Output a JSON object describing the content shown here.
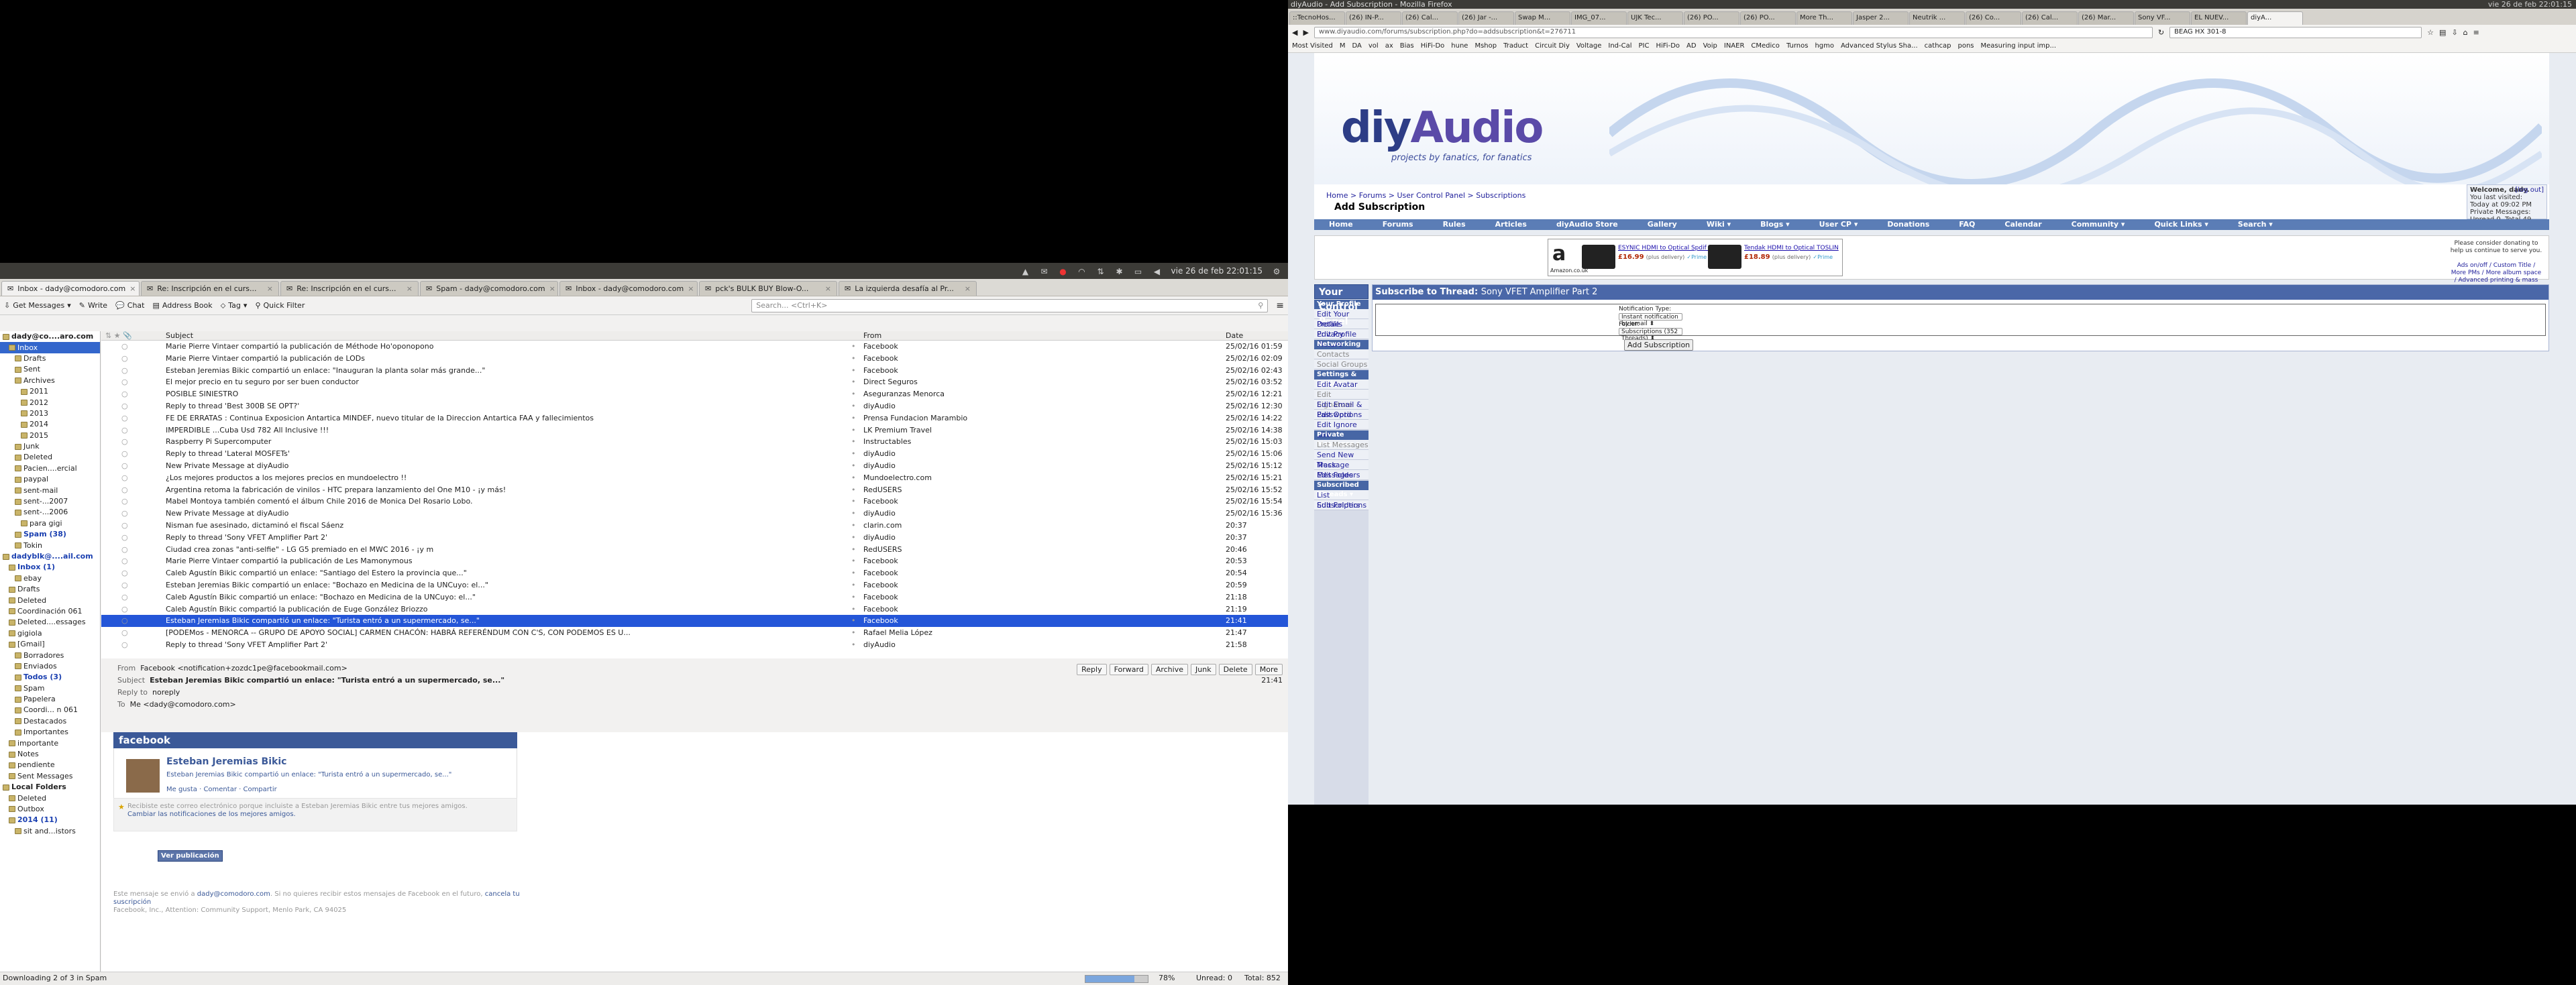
{
  "thunderbird": {
    "clock": "vie 26 de feb 22:01:15",
    "tabs": [
      {
        "label": "Inbox - dady@comodoro.com",
        "active": true
      },
      {
        "label": "Re: Inscripción en el curs...",
        "active": false
      },
      {
        "label": "Re: Inscripción en el curs...",
        "active": false
      },
      {
        "label": "Spam - dady@comodoro.com",
        "active": false
      },
      {
        "label": "Inbox - dady@comodoro.com",
        "active": false
      },
      {
        "label": "pck's BULK BUY Blow-O...",
        "active": false
      },
      {
        "label": "La izquierda desafía al Pr...",
        "active": false
      }
    ],
    "toolbar": {
      "get_messages": "Get Messages",
      "write": "Write",
      "chat": "Chat",
      "address_book": "Address Book",
      "tag": "Tag",
      "quick_filter": "Quick Filter",
      "search_placeholder": "Search... <Ctrl+K>"
    },
    "folders": [
      {
        "label": "dady@co....aro.com",
        "cls": "bold",
        "indent": 0
      },
      {
        "label": "Inbox",
        "cls": "sel",
        "indent": 1
      },
      {
        "label": "Drafts",
        "cls": "",
        "indent": 2
      },
      {
        "label": "Sent",
        "cls": "",
        "indent": 2
      },
      {
        "label": "Archives",
        "cls": "",
        "indent": 2
      },
      {
        "label": "2011",
        "cls": "",
        "indent": 3
      },
      {
        "label": "2012",
        "cls": "",
        "indent": 3
      },
      {
        "label": "2013",
        "cls": "",
        "indent": 3
      },
      {
        "label": "2014",
        "cls": "",
        "indent": 3
      },
      {
        "label": "2015",
        "cls": "",
        "indent": 3
      },
      {
        "label": "Junk",
        "cls": "",
        "indent": 2
      },
      {
        "label": "Deleted",
        "cls": "",
        "indent": 2
      },
      {
        "label": "Pacien....ercial",
        "cls": "",
        "indent": 2
      },
      {
        "label": "paypal",
        "cls": "",
        "indent": 2
      },
      {
        "label": "sent-mail",
        "cls": "",
        "indent": 2
      },
      {
        "label": "sent-...2007",
        "cls": "",
        "indent": 2
      },
      {
        "label": "sent-...2006",
        "cls": "",
        "indent": 2
      },
      {
        "label": "para gigi",
        "cls": "",
        "indent": 3
      },
      {
        "label": "Spam (38)",
        "cls": "blue",
        "indent": 2
      },
      {
        "label": "Tokin",
        "cls": "",
        "indent": 2
      },
      {
        "label": "dadyblk@....ail.com",
        "cls": "blue",
        "indent": 0
      },
      {
        "label": "Inbox (1)",
        "cls": "blue",
        "indent": 1
      },
      {
        "label": "ebay",
        "cls": "",
        "indent": 2
      },
      {
        "label": "Drafts",
        "cls": "",
        "indent": 1
      },
      {
        "label": "Deleted",
        "cls": "",
        "indent": 1
      },
      {
        "label": "Coordinación 061",
        "cls": "",
        "indent": 1
      },
      {
        "label": "Deleted....essages",
        "cls": "",
        "indent": 1
      },
      {
        "label": "gigiola",
        "cls": "",
        "indent": 1
      },
      {
        "label": "[Gmail]",
        "cls": "",
        "indent": 1
      },
      {
        "label": "Borradores",
        "cls": "",
        "indent": 2
      },
      {
        "label": "Enviados",
        "cls": "",
        "indent": 2
      },
      {
        "label": "Todos (3)",
        "cls": "blue",
        "indent": 2
      },
      {
        "label": "Spam",
        "cls": "",
        "indent": 2
      },
      {
        "label": "Papelera",
        "cls": "",
        "indent": 2
      },
      {
        "label": "Coordi... n 061",
        "cls": "",
        "indent": 2
      },
      {
        "label": "Destacados",
        "cls": "",
        "indent": 2
      },
      {
        "label": "Importantes",
        "cls": "",
        "indent": 2
      },
      {
        "label": "importante",
        "cls": "",
        "indent": 1
      },
      {
        "label": "Notes",
        "cls": "",
        "indent": 1
      },
      {
        "label": "pendiente",
        "cls": "",
        "indent": 1
      },
      {
        "label": "Sent Messages",
        "cls": "",
        "indent": 1
      },
      {
        "label": "Local Folders",
        "cls": "bold",
        "indent": 0
      },
      {
        "label": "Deleted",
        "cls": "",
        "indent": 1
      },
      {
        "label": "Outbox",
        "cls": "",
        "indent": 1
      },
      {
        "label": "2014 (11)",
        "cls": "blue",
        "indent": 1
      },
      {
        "label": "sit and...istors",
        "cls": "",
        "indent": 2
      }
    ],
    "list_headers": {
      "subject": "Subject",
      "from": "From",
      "date": "Date"
    },
    "messages": [
      {
        "subject": "Marie Pierre Vintaer compartió la publicación de Méthode Ho'oponopono",
        "from": "Facebook",
        "date": "25/02/16 01:59"
      },
      {
        "subject": "Marie Pierre Vintaer compartió la publicación de LODs",
        "from": "Facebook",
        "date": "25/02/16 02:09"
      },
      {
        "subject": "Esteban Jeremias Bikic compartió un enlace: \"Inauguran la planta solar más grande...\"",
        "from": "Facebook",
        "date": "25/02/16 02:43"
      },
      {
        "subject": "El mejor precio en tu seguro por ser buen conductor",
        "from": "Direct Seguros",
        "date": "25/02/16 03:52"
      },
      {
        "subject": "POSIBLE SINIESTRO",
        "from": "Aseguranzas Menorca",
        "date": "25/02/16 12:21"
      },
      {
        "subject": "Reply to thread 'Best 300B SE OPT?'",
        "from": "diyAudio",
        "date": "25/02/16 12:30"
      },
      {
        "subject": "FE DE ERRATAS : Continua Exposicion Antartica MINDEF, nuevo titular de la Direccion Antartica FAA y fallecimientos",
        "from": "Prensa Fundacion Marambio",
        "date": "25/02/16 14:22"
      },
      {
        "subject": "IMPERDIBLE ...Cuba Usd 782 All Inclusive !!!",
        "from": "LK Premium Travel",
        "date": "25/02/16 14:38"
      },
      {
        "subject": "Raspberry Pi Supercomputer",
        "from": "Instructables",
        "date": "25/02/16 15:03"
      },
      {
        "subject": "Reply to thread 'Lateral MOSFETs'",
        "from": "diyAudio",
        "date": "25/02/16 15:06"
      },
      {
        "subject": "New Private Message at diyAudio",
        "from": "diyAudio",
        "date": "25/02/16 15:12"
      },
      {
        "subject": "¿Los mejores productos a los mejores precios en mundoelectro !!",
        "from": "Mundoelectro.com",
        "date": "25/02/16 15:21"
      },
      {
        "subject": "Argentina retoma la fabricación de vinilos - HTC prepara lanzamiento del One M10 - ¡y más!",
        "from": "RedUSERS",
        "date": "25/02/16 15:52"
      },
      {
        "subject": "Mabel Montoya también comentó el álbum Chile 2016 de Monica Del Rosario Lobo.",
        "from": "Facebook",
        "date": "25/02/16 15:54"
      },
      {
        "subject": "New Private Message at diyAudio",
        "from": "diyAudio",
        "date": "25/02/16 15:36"
      },
      {
        "subject": "Nisman fue asesinado, dictaminó el fiscal Sáenz",
        "from": "clarin.com",
        "date": "20:37"
      },
      {
        "subject": "Reply to thread 'Sony VFET Amplifier Part 2'",
        "from": "diyAudio",
        "date": "20:37"
      },
      {
        "subject": "Ciudad crea zonas \"anti-selfie\" - LG G5 premiado en el MWC 2016 - ¡y m",
        "from": "RedUSERS",
        "date": "20:46"
      },
      {
        "subject": "Marie Pierre Vintaer compartió la publicación de Les Mamonymous",
        "from": "Facebook",
        "date": "20:53"
      },
      {
        "subject": "Caleb Agustín Bikic compartió un enlace: \"Santiago del Estero la provincia que...\"",
        "from": "Facebook",
        "date": "20:54"
      },
      {
        "subject": "Esteban Jeremias Bikic compartió un enlace: \"Bochazo en Medicina de la UNCuyo: el...\"",
        "from": "Facebook",
        "date": "20:59"
      },
      {
        "subject": "Caleb Agustín Bikic compartió un enlace: \"Bochazo en Medicina de la UNCuyo: el...\"",
        "from": "Facebook",
        "date": "21:18"
      },
      {
        "subject": "Caleb Agustín Bikic compartió la publicación de Euge González Briozzo",
        "from": "Facebook",
        "date": "21:19"
      },
      {
        "subject": "Esteban Jeremias Bikic compartió un enlace: \"Turista entró a un supermercado, se...\"",
        "from": "Facebook",
        "date": "21:41",
        "sel": true
      },
      {
        "subject": "[PODEMos - MENORCA -- GRUPO DE APOYO SOCIAL] CARMEN CHACÓN: HABRÁ REFERÉNDUM CON C'S, CON PODEMOS ES U...",
        "from": "Rafael Melia López",
        "date": "21:47"
      },
      {
        "subject": "Reply to thread 'Sony VFET Amplifier Part 2'",
        "from": "diyAudio",
        "date": "21:58"
      }
    ],
    "header": {
      "from_label": "From",
      "from": "Facebook <notification+zozdc1pe@facebookmail.com>",
      "subject_label": "Subject",
      "subject": "Esteban Jeremias Bikic compartió un enlace: \"Turista entró a un supermercado, se...\"",
      "replyto_label": "Reply to",
      "replyto": "noreply",
      "to_label": "To",
      "to": "Me <dady@comodoro.com>",
      "time": "21:41",
      "buttons": [
        "Reply",
        "Forward",
        "Archive",
        "Junk",
        "Delete",
        "More"
      ]
    },
    "body": {
      "fb_header": "facebook",
      "name": "Esteban Jeremias Bikic",
      "line": "Esteban Jeremias Bikic compartió un enlace: \"Turista entró a un supermercado, se...\"",
      "actions": "Me gusta · Comentar · Compartir",
      "note1": "Recibiste este correo electrónico porque incluiste a Esteban Jeremias Bikic entre tus mejores amigos.",
      "note2": "Cambiar las notificaciones de los mejores amigos.",
      "button": "Ver publicación",
      "foot1a": "Este mensaje se envió a ",
      "foot1email": "dady@comodoro.com",
      "foot1b": ". Si no quieres recibir estos mensajes de Facebook en el futuro, ",
      "foot1link": "cancela tu suscripción",
      "foot2": "Facebook, Inc., Attention: Community Support, Menlo Park, CA 94025"
    },
    "status": {
      "left": "Downloading 2 of 3 in Spam",
      "percent": "78%",
      "progress": 0.78,
      "unread": "Unread: 0",
      "total": "Total: 852"
    }
  },
  "firefox": {
    "title": "diyAudio - Add Subscription - Mozilla Firefox",
    "clock": "vie 26 de feb 22:01:15",
    "tabs": [
      "::TecnoHos...",
      "(26) IN-P...",
      "(26) Cal...",
      "(26) Jar -...",
      "Swap M...",
      "IMG_07...",
      "UJK Tec...",
      "(26) PO...",
      "(26) PO...",
      "More Th...",
      "Jasper 2...",
      "Neutrik ...",
      "(26) Co...",
      "(26) Cal...",
      "(26) Mar...",
      "Sony VF...",
      "EL NUEV...",
      "diyA..."
    ],
    "url": "www.diyaudio.com/forums/subscription.php?do=addsubscription&t=276711",
    "search": "BEAG HX 301-8",
    "bookmarks": [
      "Most Visited",
      "M",
      "DA",
      "vol",
      "ax",
      "Bias",
      "HiFi-Do",
      "hune",
      "Mshop",
      "Traduct",
      "Circuit Diy",
      "Voltage",
      "Ind-Cal",
      "PIC",
      "HiFi-Do",
      "AD",
      "Voip",
      "INAER",
      "CMedico",
      "Turnos",
      "hgmo",
      "Advanced Stylus Sha...",
      "cathcap",
      "pons",
      "Measuring input imp..."
    ],
    "logo_a": "diy",
    "logo_b": "Audio",
    "logo_sub": "projects by fanatics, for fanatics",
    "crumb": "Home > Forums > User Control Panel > Subscriptions",
    "page_title": "Add Subscription",
    "welcome": {
      "w": "Welcome, dady.",
      "lv": "You last visited: Today at 09:02 PM",
      "pm": "Private Messages: Unread 0, Total 49.",
      "logout": "[log out]"
    },
    "nav": [
      "Home",
      "Forums",
      "Rules",
      "Articles",
      "diyAudio Store",
      "Gallery",
      "Wiki ▾",
      "Blogs ▾",
      "User CP ▾",
      "Donations",
      "FAQ",
      "Calendar",
      "Community ▾",
      "Quick Links ▾",
      "Search ▾"
    ],
    "ad": {
      "p1": "ESYNIC HDMI to Optical Spdif Toslink Cor",
      "pr1": "£16.99",
      "p2": "Tendak HDMI to Optical TOSLIN",
      "pr2": "£18.89",
      "plus": "(plus delivery)",
      "prime": "✓Prime",
      "brand": "Amazon.co.uk"
    },
    "donate": "Please consider donating to help us continue to serve you.",
    "donate2": "Ads on/off / Custom Title / More PMs / More album space / Advanced printing & mass image saving",
    "cpanel": {
      "title": "Your Control Panel",
      "sections": [
        {
          "h": "Your Profile",
          "items": [
            "Edit Your Details",
            "Profile Privacy",
            "Edit Profile Picture"
          ]
        },
        {
          "h": "Networking",
          "items": [
            "Contacts",
            "Social Groups"
          ]
        },
        {
          "h": "Settings & Options",
          "items": [
            "Edit Avatar",
            "Edit Signature",
            "Edit Email & Password",
            "Edit Options",
            "Edit Ignore List"
          ]
        },
        {
          "h": "Private Messages ▾",
          "items": [
            "List Messages",
            "Send New Message",
            "Track Messages",
            "Edit Folders"
          ]
        },
        {
          "h": "Subscribed Threads ▾",
          "items": [
            "List Subscriptions",
            "Edit Folders"
          ]
        }
      ]
    },
    "subscribe": {
      "title": "Subscribe to Thread:",
      "thread": "Sony VFET Amplifier Part 2",
      "notif_label": "Notification Type:",
      "notif_value": "Instant notification by email",
      "folder_label": "Folder:",
      "folder_value": "Subscriptions (352 Threads)",
      "button": "Add Subscription"
    }
  }
}
